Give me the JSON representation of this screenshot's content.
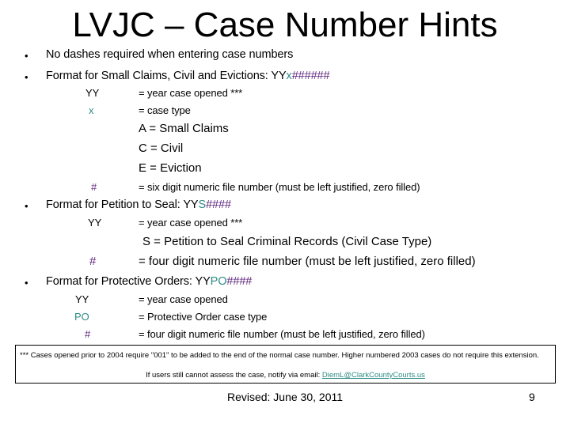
{
  "title": "LVJC – Case Number Hints",
  "bullet_char": "•",
  "colors": {
    "case_type": "#2e8b86",
    "number": "#5b1f7a",
    "link": "#2e8b86"
  },
  "bullets": [
    {
      "text": "No dashes required when entering case numbers"
    },
    {
      "prefix": "Format for Small Claims, Civil and Evictions: YY",
      "type": "x",
      "num": "######"
    },
    {
      "prefix": "Format for Petition to Seal:  YY",
      "type": "S",
      "num": "####"
    },
    {
      "prefix": "Format for Protective Orders:  YY",
      "type": "PO",
      "num": "####"
    }
  ],
  "small_claims": {
    "yy": {
      "term": "YY",
      "def": "= year case opened   ***"
    },
    "x": {
      "term": "x",
      "def": "= case type"
    },
    "types": [
      "A = Small Claims",
      "C = Civil",
      "E = Eviction"
    ],
    "hash": {
      "term": "#",
      "def": "= six digit numeric file number (must be left justified, zero filled)"
    }
  },
  "petition": {
    "yy": {
      "term": "YY",
      "def": "= year case opened   ***"
    },
    "s": "S = Petition to Seal Criminal Records (Civil Case Type)",
    "hash": {
      "term": "#",
      "def": "= four digit numeric file number (must be left justified, zero filled)"
    }
  },
  "protective": {
    "yy": {
      "term": "YY",
      "def": "= year case opened"
    },
    "po": {
      "term": "PO",
      "def": "= Protective Order case type"
    },
    "hash": {
      "term": "#",
      "def": "= four digit numeric file number (must be left justified, zero filled)"
    }
  },
  "note": {
    "text": "*** Cases opened prior to 2004 require \"001\" to be added to the end of the normal case number.  Higher numbered 2003 cases do not require this extension.",
    "contact_prefix": "If users still cannot assess the case, notify via email: ",
    "email": "DiemL@ClarkCountyCourts.us"
  },
  "footer": {
    "revised": "Revised: June 30, 2011",
    "page": "9"
  }
}
